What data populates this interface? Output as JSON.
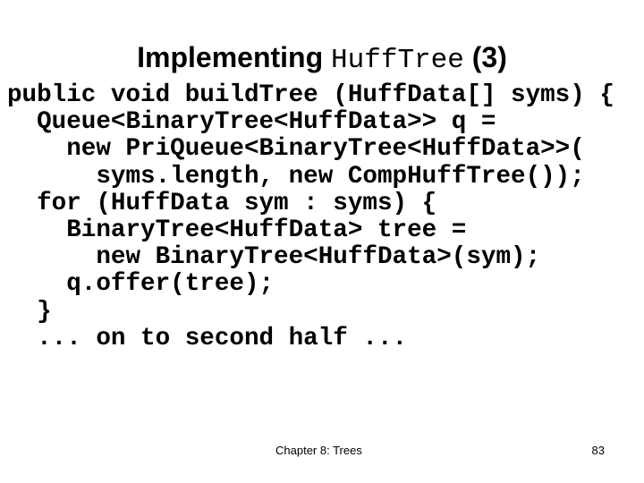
{
  "slide": {
    "title": {
      "prefix": "Implementing ",
      "code": "HuffTree",
      "suffix": " (3)"
    },
    "code_lines": [
      "public void buildTree (HuffData[] syms) {",
      "  Queue<BinaryTree<HuffData>> q =",
      "    new PriQueue<BinaryTree<HuffData>>(",
      "      syms.length, new CompHuffTree());",
      "  for (HuffData sym : syms) {",
      "    BinaryTree<HuffData> tree =",
      "      new BinaryTree<HuffData>(sym);",
      "    q.offer(tree);",
      "  }",
      "  ... on to second half ..."
    ],
    "footer": {
      "chapter": "Chapter 8: Trees",
      "page_number": "83"
    }
  }
}
